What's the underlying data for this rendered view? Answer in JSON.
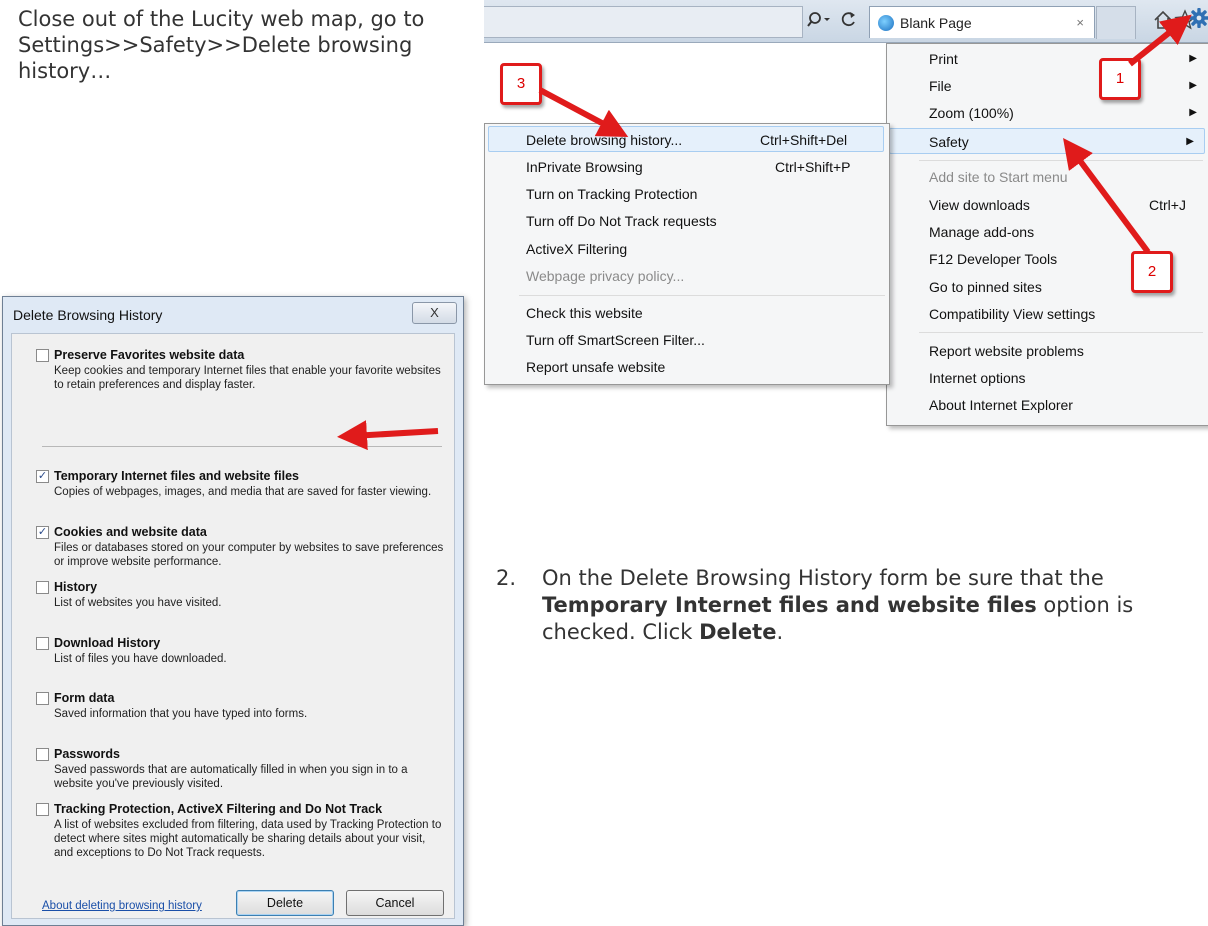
{
  "instructions": {
    "intro": "Close out of the Lucity web map, go to Settings>>Safety>>Delete browsing history…",
    "step2_number": "2.",
    "step2_parts": [
      "On the Delete Browsing History form be sure that the ",
      "Temporary Internet files and website files",
      " option is checked.  Click ",
      "Delete",
      "."
    ]
  },
  "toolbar": {
    "search_icon": "search-dropdown-icon",
    "refresh_icon": "refresh-icon",
    "tab_title": "Blank Page",
    "tab_close": "×",
    "home_icon": "home-icon",
    "favorites_icon": "star-icon",
    "tools_icon": "gear-icon"
  },
  "main_menu": {
    "items": [
      {
        "label": "Print",
        "submenu": true
      },
      {
        "label": "File",
        "submenu": true
      },
      {
        "label": "Zoom (100%)",
        "submenu": true
      },
      {
        "label": "Safety",
        "submenu": true,
        "highlight": true
      },
      {
        "label": "Add site to Start menu",
        "disabled": true
      },
      {
        "label": "View downloads",
        "shortcut": "Ctrl+J"
      },
      {
        "label": "Manage add-ons"
      },
      {
        "label": "F12 Developer Tools"
      },
      {
        "label": "Go to pinned sites"
      },
      {
        "label": "Compatibility View settings"
      },
      {
        "label": "Report website problems"
      },
      {
        "label": "Internet options"
      },
      {
        "label": "About Internet Explorer"
      }
    ]
  },
  "safety_menu": {
    "items": [
      {
        "label": "Delete browsing history...",
        "shortcut": "Ctrl+Shift+Del",
        "highlight": true
      },
      {
        "label": "InPrivate Browsing",
        "shortcut": "Ctrl+Shift+P"
      },
      {
        "label": "Turn on Tracking Protection"
      },
      {
        "label": "Turn off Do Not Track requests"
      },
      {
        "label": "ActiveX Filtering"
      },
      {
        "label": "Webpage privacy policy...",
        "disabled": true
      },
      {
        "label": "Check this website"
      },
      {
        "label": "Turn off SmartScreen Filter..."
      },
      {
        "label": "Report unsafe website"
      }
    ]
  },
  "callouts": [
    "1",
    "2",
    "3"
  ],
  "dialog": {
    "title": "Delete Browsing History",
    "close": "X",
    "options": [
      {
        "title": "Preserve Favorites website data",
        "checked": false,
        "desc": "Keep cookies and temporary Internet files that enable your favorite websites to retain preferences and display faster."
      },
      {
        "title": "Temporary Internet files and website files",
        "checked": true,
        "desc": "Copies of webpages, images, and media that are saved for faster viewing."
      },
      {
        "title": "Cookies and website data",
        "checked": true,
        "desc": "Files or databases stored on your computer by websites to save preferences or improve website performance."
      },
      {
        "title": "History",
        "checked": false,
        "desc": "List of websites you have visited."
      },
      {
        "title": "Download History",
        "checked": false,
        "desc": "List of files you have downloaded."
      },
      {
        "title": "Form data",
        "checked": false,
        "desc": "Saved information that you have typed into forms."
      },
      {
        "title": "Passwords",
        "checked": false,
        "desc": "Saved passwords that are automatically filled in when you sign in to a website you've previously visited."
      },
      {
        "title": "Tracking Protection, ActiveX Filtering and Do Not Track",
        "checked": false,
        "desc": "A list of websites excluded from filtering, data used by Tracking Protection to detect where sites might automatically be sharing details about your visit, and exceptions to Do Not Track requests."
      }
    ],
    "link": "About deleting browsing history",
    "delete_label": "Delete",
    "cancel_label": "Cancel"
  },
  "colors": {
    "callout_red": "#e01b1b",
    "highlight_bg": "#e5f0fb",
    "link_blue": "#1a4fa8"
  }
}
